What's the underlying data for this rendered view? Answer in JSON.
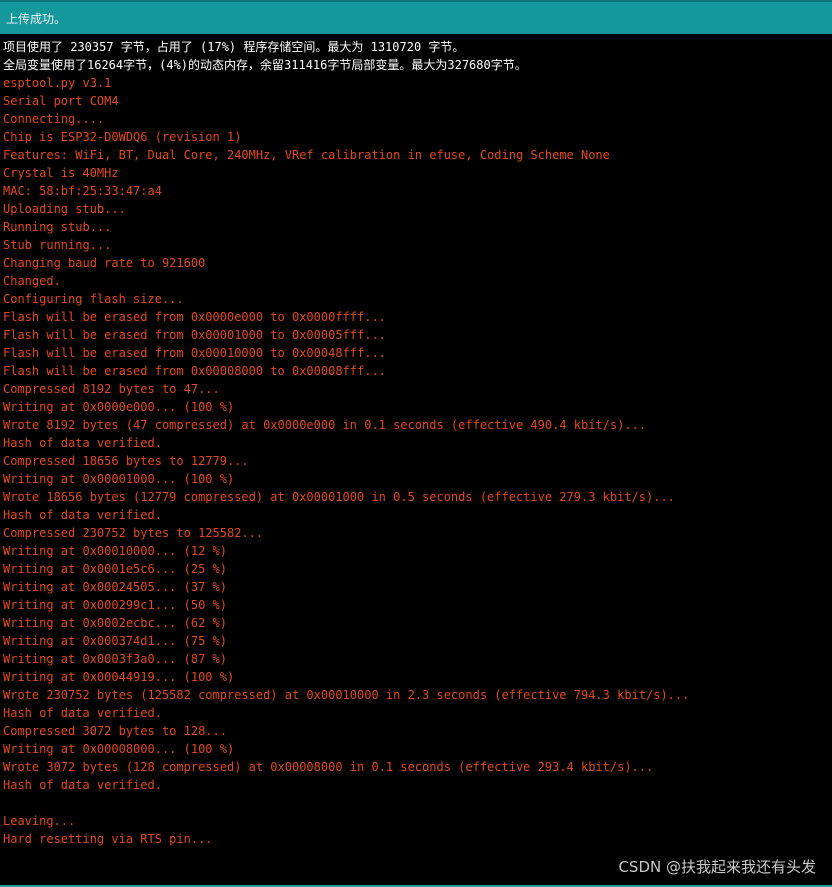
{
  "status_bar": {
    "message": "上传成功。"
  },
  "console": {
    "lines": [
      {
        "text": "项目使用了 230357 字节，占用了 (17%) 程序存储空间。最大为 1310720 字节。",
        "color": "white"
      },
      {
        "text": "全局变量使用了16264字节，(4%)的动态内存，余留311416字节局部变量。最大为327680字节。",
        "color": "white"
      },
      {
        "text": "esptool.py v3.1",
        "color": "orange"
      },
      {
        "text": "Serial port COM4",
        "color": "orange"
      },
      {
        "text": "Connecting....",
        "color": "orange"
      },
      {
        "text": "Chip is ESP32-D0WDQ6 (revision 1)",
        "color": "orange"
      },
      {
        "text": "Features: WiFi, BT, Dual Core, 240MHz, VRef calibration in efuse, Coding Scheme None",
        "color": "orange"
      },
      {
        "text": "Crystal is 40MHz",
        "color": "orange"
      },
      {
        "text": "MAC: 58:bf:25:33:47:a4",
        "color": "orange"
      },
      {
        "text": "Uploading stub...",
        "color": "orange"
      },
      {
        "text": "Running stub...",
        "color": "orange"
      },
      {
        "text": "Stub running...",
        "color": "orange"
      },
      {
        "text": "Changing baud rate to 921600",
        "color": "orange"
      },
      {
        "text": "Changed.",
        "color": "orange"
      },
      {
        "text": "Configuring flash size...",
        "color": "orange"
      },
      {
        "text": "Flash will be erased from 0x0000e000 to 0x0000ffff...",
        "color": "orange"
      },
      {
        "text": "Flash will be erased from 0x00001000 to 0x00005fff...",
        "color": "orange"
      },
      {
        "text": "Flash will be erased from 0x00010000 to 0x00048fff...",
        "color": "orange"
      },
      {
        "text": "Flash will be erased from 0x00008000 to 0x00008fff...",
        "color": "orange"
      },
      {
        "text": "Compressed 8192 bytes to 47...",
        "color": "orange"
      },
      {
        "text": "Writing at 0x0000e000... (100 %)",
        "color": "orange"
      },
      {
        "text": "Wrote 8192 bytes (47 compressed) at 0x0000e000 in 0.1 seconds (effective 490.4 kbit/s)...",
        "color": "orange"
      },
      {
        "text": "Hash of data verified.",
        "color": "orange"
      },
      {
        "text": "Compressed 18656 bytes to 12779...",
        "color": "orange"
      },
      {
        "text": "Writing at 0x00001000... (100 %)",
        "color": "orange"
      },
      {
        "text": "Wrote 18656 bytes (12779 compressed) at 0x00001000 in 0.5 seconds (effective 279.3 kbit/s)...",
        "color": "orange"
      },
      {
        "text": "Hash of data verified.",
        "color": "orange"
      },
      {
        "text": "Compressed 230752 bytes to 125582...",
        "color": "orange"
      },
      {
        "text": "Writing at 0x00010000... (12 %)",
        "color": "orange"
      },
      {
        "text": "Writing at 0x0001e5c6... (25 %)",
        "color": "orange"
      },
      {
        "text": "Writing at 0x00024505... (37 %)",
        "color": "orange"
      },
      {
        "text": "Writing at 0x000299c1... (50 %)",
        "color": "orange"
      },
      {
        "text": "Writing at 0x0002ecbc... (62 %)",
        "color": "orange"
      },
      {
        "text": "Writing at 0x000374d1... (75 %)",
        "color": "orange"
      },
      {
        "text": "Writing at 0x0003f3a0... (87 %)",
        "color": "orange"
      },
      {
        "text": "Writing at 0x00044919... (100 %)",
        "color": "orange"
      },
      {
        "text": "Wrote 230752 bytes (125582 compressed) at 0x00010000 in 2.3 seconds (effective 794.3 kbit/s)...",
        "color": "orange"
      },
      {
        "text": "Hash of data verified.",
        "color": "orange"
      },
      {
        "text": "Compressed 3072 bytes to 128...",
        "color": "orange"
      },
      {
        "text": "Writing at 0x00008000... (100 %)",
        "color": "orange"
      },
      {
        "text": "Wrote 3072 bytes (128 compressed) at 0x00008000 in 0.1 seconds (effective 293.4 kbit/s)...",
        "color": "orange"
      },
      {
        "text": "Hash of data verified.",
        "color": "orange"
      },
      {
        "text": "",
        "color": "orange"
      },
      {
        "text": "Leaving...",
        "color": "orange"
      },
      {
        "text": "Hard resetting via RTS pin...",
        "color": "orange"
      }
    ]
  },
  "watermark": {
    "text": "CSDN @扶我起来我还有头发"
  },
  "colors": {
    "status_bar_bg": "#17a1a5",
    "console_bg": "#000000",
    "white_text": "#ffffff",
    "orange_text": "#e24a1a"
  }
}
